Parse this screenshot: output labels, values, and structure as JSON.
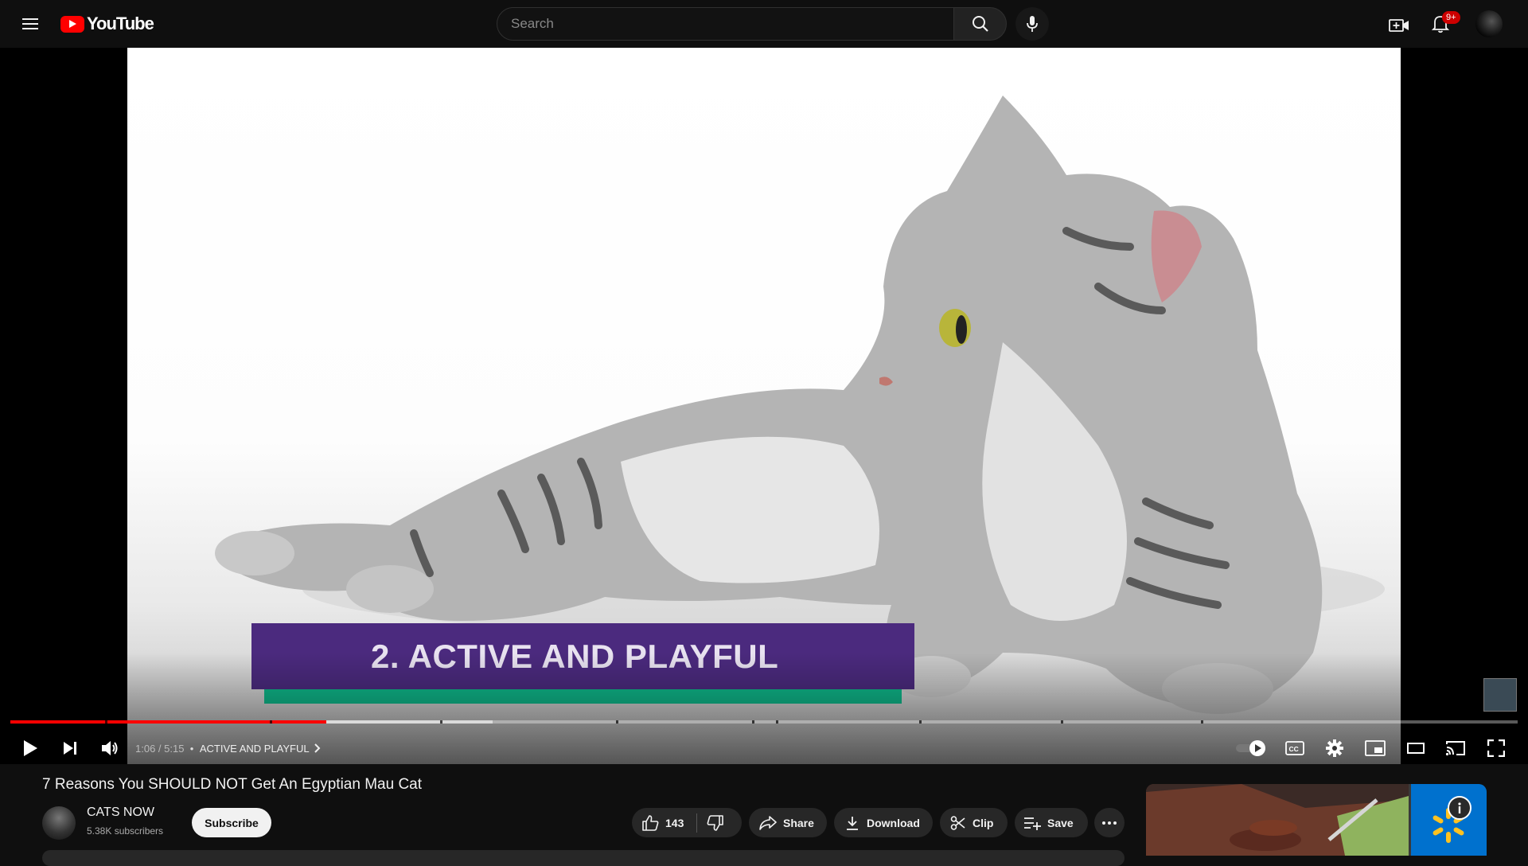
{
  "header": {
    "logo_text": "YouTube",
    "search_placeholder": "Search",
    "notification_badge": "9+"
  },
  "player": {
    "overlay_title": "2. ACTIVE AND PLAYFUL",
    "current_time": "1:06",
    "duration": "5:15",
    "chapter_label": "ACTIVE AND PLAYFUL",
    "progress_fraction": 0.2095,
    "buffered_fraction": 0.32,
    "chapter_fractions": [
      0.063,
      0.172,
      0.285,
      0.402,
      0.492,
      0.508,
      0.603,
      0.697,
      0.79
    ]
  },
  "video": {
    "title": "7 Reasons You SHOULD NOT Get An Egyptian Mau Cat",
    "channel_name": "CATS NOW",
    "subscribers": "5.38K subscribers",
    "subscribe_label": "Subscribe",
    "like_count": "143",
    "share_label": "Share",
    "download_label": "Download",
    "clip_label": "Clip",
    "save_label": "Save"
  },
  "colors": {
    "accent": "#ff0000",
    "lower_third": "#4b2a7e",
    "lower_third_bar": "#0fb88a",
    "ad_brand": "#0071ce"
  }
}
